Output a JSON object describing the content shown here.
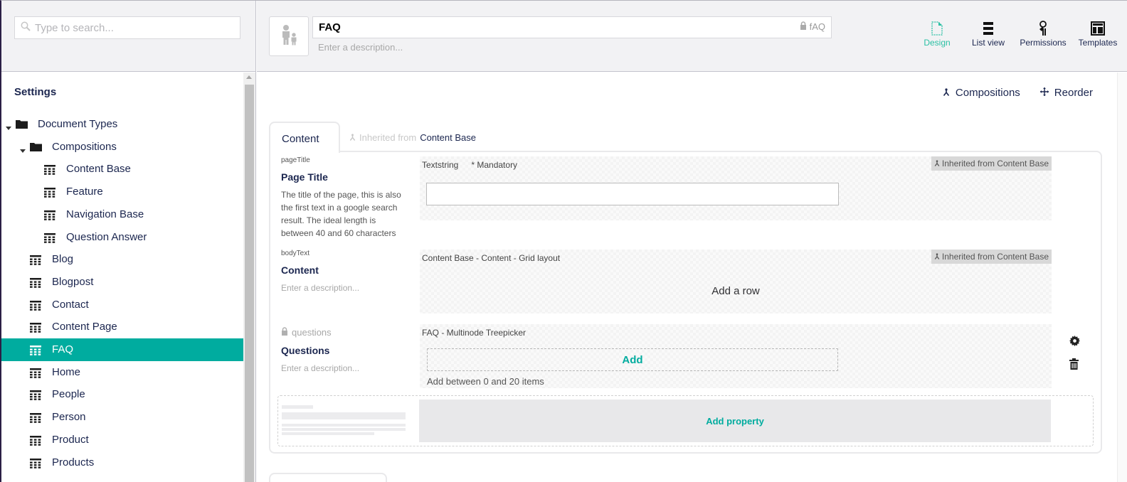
{
  "sidebar": {
    "search_placeholder": "Type to search...",
    "section_title": "Settings",
    "tree": [
      {
        "label": "Document Types",
        "type": "folder",
        "level": 0,
        "expanded": true
      },
      {
        "label": "Compositions",
        "type": "folder",
        "level": 1,
        "expanded": true
      },
      {
        "label": "Content Base",
        "type": "doctype",
        "level": 2
      },
      {
        "label": "Feature",
        "type": "doctype",
        "level": 2
      },
      {
        "label": "Navigation Base",
        "type": "doctype",
        "level": 2
      },
      {
        "label": "Question Answer",
        "type": "doctype",
        "level": 2
      },
      {
        "label": "Blog",
        "type": "doctype",
        "level": 1
      },
      {
        "label": "Blogpost",
        "type": "doctype",
        "level": 1
      },
      {
        "label": "Contact",
        "type": "doctype",
        "level": 1
      },
      {
        "label": "Content Page",
        "type": "doctype",
        "level": 1
      },
      {
        "label": "FAQ",
        "type": "doctype",
        "level": 1,
        "selected": true
      },
      {
        "label": "Home",
        "type": "doctype",
        "level": 1
      },
      {
        "label": "People",
        "type": "doctype",
        "level": 1
      },
      {
        "label": "Person",
        "type": "doctype",
        "level": 1
      },
      {
        "label": "Product",
        "type": "doctype",
        "level": 1
      },
      {
        "label": "Products",
        "type": "doctype",
        "level": 1
      }
    ]
  },
  "header": {
    "icon": "family-icon",
    "name_value": "FAQ",
    "alias": "fAQ",
    "description_placeholder": "Enter a description...",
    "nav": [
      {
        "label": "Design",
        "icon": "document-icon",
        "active": true
      },
      {
        "label": "List view",
        "icon": "list-icon",
        "active": false
      },
      {
        "label": "Permissions",
        "icon": "permissions-icon",
        "active": false
      },
      {
        "label": "Templates",
        "icon": "template-icon",
        "active": false
      }
    ]
  },
  "toolbar": {
    "compositions_label": "Compositions",
    "reorder_label": "Reorder"
  },
  "group": {
    "tab_label": "Content",
    "inherited_prefix": "Inherited from",
    "inherited_from": "Content Base"
  },
  "properties": [
    {
      "alias": "pageTitle",
      "name": "Page Title",
      "description": "The title of the page, this is also the first text in a google search result. The ideal length is between 40 and 60 characters",
      "editor": "Textstring",
      "mandatory": "* Mandatory",
      "inherited_badge": "Inherited from Content Base"
    },
    {
      "alias": "bodyText",
      "name": "Content",
      "description_placeholder": "Enter a description...",
      "editor": "Content Base - Content - Grid layout",
      "preview_text": "Add a row",
      "inherited_badge": "Inherited from Content Base"
    },
    {
      "alias": "questions",
      "locked": true,
      "name": "Questions",
      "description_placeholder": "Enter a description...",
      "editor": "FAQ - Multinode Treepicker",
      "add_label": "Add",
      "hint": "Add between 0 and 20 items"
    }
  ],
  "add_property_label": "Add property",
  "colors": {
    "accent": "#00ac9f",
    "design_active": "#2bc0a4",
    "text": "#1b264f",
    "badge_bg": "#d8d8d8"
  }
}
